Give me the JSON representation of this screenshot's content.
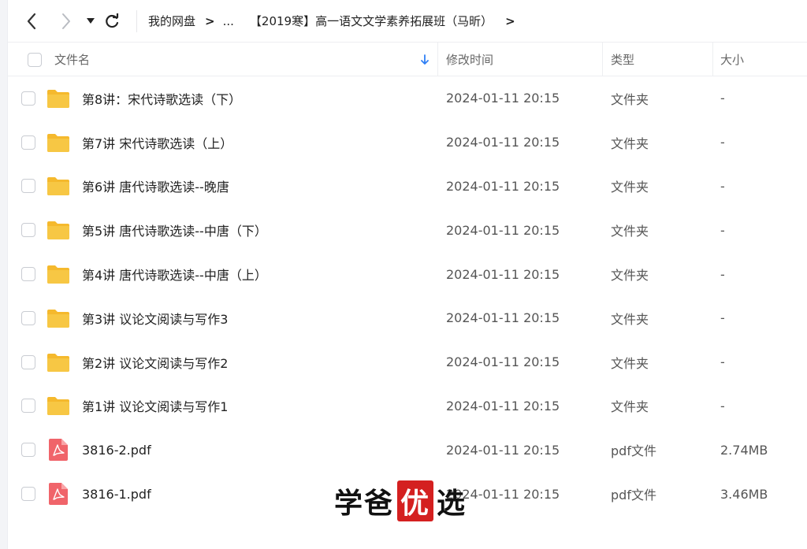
{
  "breadcrumb": {
    "root": "我的网盘",
    "ellipsis": "...",
    "current": "【2019寒】高一语文文学素养拓展班（马昕）"
  },
  "columns": {
    "name": "文件名",
    "time": "修改时间",
    "type": "类型",
    "size": "大小"
  },
  "files": [
    {
      "icon": "folder-icon",
      "name": "第8讲：宋代诗歌选读（下）",
      "time": "2024-01-11 20:15",
      "type": "文件夹",
      "size": "-"
    },
    {
      "icon": "folder-icon",
      "name": "第7讲 宋代诗歌选读（上）",
      "time": "2024-01-11 20:15",
      "type": "文件夹",
      "size": "-"
    },
    {
      "icon": "folder-icon",
      "name": "第6讲 唐代诗歌选读--晚唐",
      "time": "2024-01-11 20:15",
      "type": "文件夹",
      "size": "-"
    },
    {
      "icon": "folder-icon",
      "name": "第5讲 唐代诗歌选读--中唐（下）",
      "time": "2024-01-11 20:15",
      "type": "文件夹",
      "size": "-"
    },
    {
      "icon": "folder-icon",
      "name": "第4讲 唐代诗歌选读--中唐（上）",
      "time": "2024-01-11 20:15",
      "type": "文件夹",
      "size": "-"
    },
    {
      "icon": "folder-icon",
      "name": "第3讲 议论文阅读与写作3",
      "time": "2024-01-11 20:15",
      "type": "文件夹",
      "size": "-"
    },
    {
      "icon": "folder-icon",
      "name": "第2讲 议论文阅读与写作2",
      "time": "2024-01-11 20:15",
      "type": "文件夹",
      "size": "-"
    },
    {
      "icon": "folder-icon",
      "name": "第1讲 议论文阅读与写作1",
      "time": "2024-01-11 20:15",
      "type": "文件夹",
      "size": "-"
    },
    {
      "icon": "pdf-icon",
      "name": "3816-2.pdf",
      "time": "2024-01-11 20:15",
      "type": "pdf文件",
      "size": "2.74MB"
    },
    {
      "icon": "pdf-icon",
      "name": "3816-1.pdf",
      "time": "2024-01-11 20:15",
      "type": "pdf文件",
      "size": "3.46MB"
    }
  ],
  "watermark": {
    "part1": "学爸",
    "part2": "优",
    "part3": "选"
  },
  "colors": {
    "folder": "#f7c744",
    "pdf": "#f0646a",
    "sort_accent": "#2f7ff5"
  }
}
